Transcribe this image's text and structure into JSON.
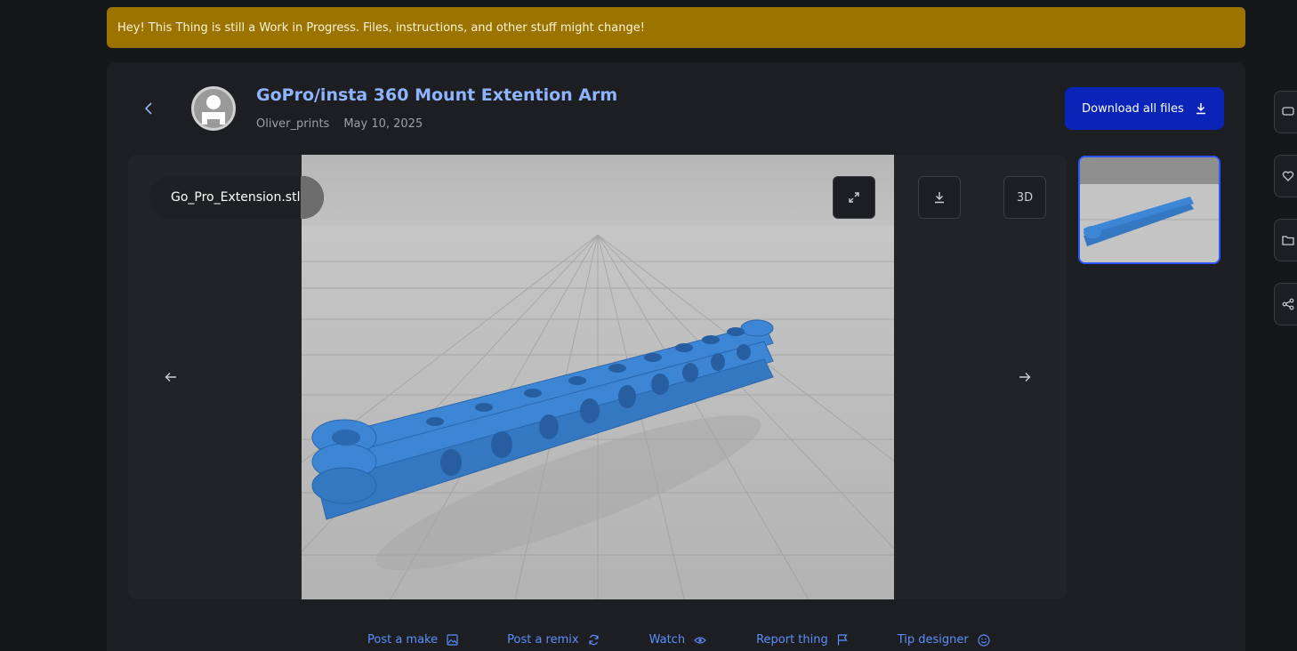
{
  "banner": {
    "text": "Hey! This Thing is still a Work in Progress. Files, instructions, and other stuff might change!"
  },
  "thing": {
    "title": "GoPro/insta 360 Mount Extention Arm",
    "author": "Oliver_prints",
    "date": "May 10, 2025"
  },
  "download_all": {
    "label": "Download all files",
    "icon": "download-icon"
  },
  "viewer": {
    "filename": "Go_Pro_Extension.stl",
    "btn_3d": "3D",
    "icons": [
      "expand-icon",
      "download-icon",
      "arrow-left-icon",
      "arrow-right-icon"
    ]
  },
  "actions": [
    {
      "label": "Post a make",
      "icon": "image-icon"
    },
    {
      "label": "Post a remix",
      "icon": "refresh-icon"
    },
    {
      "label": "Watch",
      "icon": "eye-icon"
    },
    {
      "label": "Report thing",
      "icon": "flag-icon"
    },
    {
      "label": "Tip designer",
      "icon": "smile-icon"
    }
  ],
  "side_icons": [
    "comment-icon",
    "heart-icon",
    "folder-icon",
    "share-icon"
  ],
  "colors": {
    "banner": "#9a7300",
    "accent": "#8fb4ff",
    "link": "#5b8fff",
    "primary_button": "#0a24b8",
    "model": "#3d86d6"
  }
}
